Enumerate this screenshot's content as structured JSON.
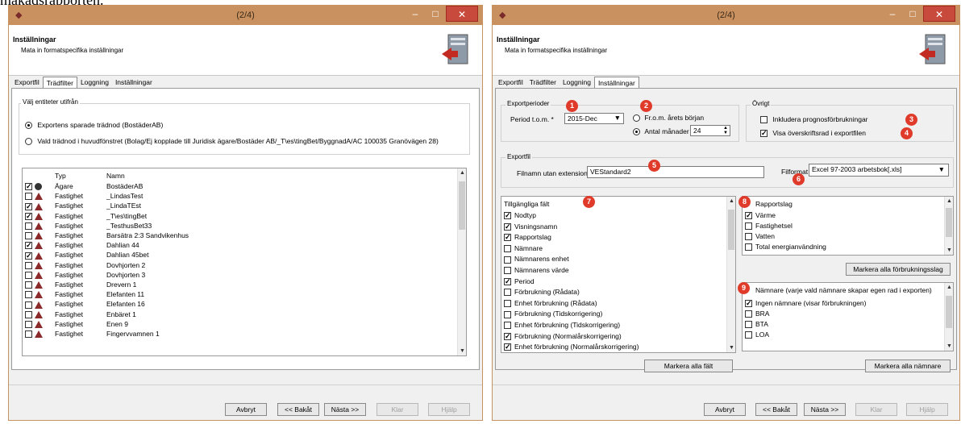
{
  "top_text": "makadsrapporten.",
  "window1": {
    "title": "(2/4)",
    "header": {
      "title": "Inställningar",
      "subtitle": "Mata in formatspecifika inställningar"
    },
    "tabs": [
      "Exportfil",
      "Trädfilter",
      "Loggning",
      "Inställningar"
    ],
    "group_label": "Välj entiteter utifrån",
    "radio1": "Exportens sparade trädnod (BostäderAB)",
    "radio2": "Vald trädnod i huvudfönstret (Bolag/Ej kopplade till Juridisk ägare/Bostäder AB/_T\\es\\tingBet/ByggnadA/AC 100035 Granövägen 28)",
    "columns": {
      "typ": "Typ",
      "namn": "Namn"
    },
    "rows": [
      {
        "checked": true,
        "icon": "owner-icon",
        "typ": "Ägare",
        "namn": "BostäderAB"
      },
      {
        "checked": false,
        "icon": "property-icon",
        "typ": "Fastighet",
        "namn": "_LindasTest"
      },
      {
        "checked": true,
        "icon": "property-icon",
        "typ": "Fastighet",
        "namn": "_LindaTEst"
      },
      {
        "checked": true,
        "icon": "property-icon",
        "typ": "Fastighet",
        "namn": "_T\\es\\tingBet"
      },
      {
        "checked": false,
        "icon": "property-icon",
        "typ": "Fastighet",
        "namn": "_TesthusBet33"
      },
      {
        "checked": false,
        "icon": "property-icon",
        "typ": "Fastighet",
        "namn": "Barsätra 2:3 Sandvikenhus"
      },
      {
        "checked": true,
        "icon": "property-icon",
        "typ": "Fastighet",
        "namn": "Dahlian 44"
      },
      {
        "checked": true,
        "icon": "property-icon",
        "typ": "Fastighet",
        "namn": "Dahlian 45bet"
      },
      {
        "checked": false,
        "icon": "property-icon",
        "typ": "Fastighet",
        "namn": "Dovhjorten 2"
      },
      {
        "checked": false,
        "icon": "property-icon",
        "typ": "Fastighet",
        "namn": "Dovhjorten 3"
      },
      {
        "checked": false,
        "icon": "property-icon",
        "typ": "Fastighet",
        "namn": "Drevern 1"
      },
      {
        "checked": false,
        "icon": "property-icon",
        "typ": "Fastighet",
        "namn": "Elefanten 11"
      },
      {
        "checked": false,
        "icon": "property-icon",
        "typ": "Fastighet",
        "namn": "Elefanten 16"
      },
      {
        "checked": false,
        "icon": "property-icon",
        "typ": "Fastighet",
        "namn": "Enbäret 1"
      },
      {
        "checked": false,
        "icon": "property-icon",
        "typ": "Fastighet",
        "namn": "Enen 9"
      },
      {
        "checked": false,
        "icon": "property-icon",
        "typ": "Fastighet",
        "namn": "Fingervvamnen 1"
      }
    ],
    "buttons": {
      "cancel": "Avbryt",
      "back": "<< Bakåt",
      "next": "Nästa >>",
      "finish": "Klar",
      "help": "Hjälp"
    }
  },
  "window2": {
    "title": "(2/4)",
    "header": {
      "title": "Inställningar",
      "subtitle": "Mata in formatspecifika inställningar"
    },
    "tabs": [
      "Exportfil",
      "Trädfilter",
      "Loggning",
      "Inställningar"
    ],
    "exportperioder": {
      "label": "Exportperioder",
      "period_label": "Period t.o.m. *",
      "period_value": "2015-Dec",
      "radio_from_year": "Fr.o.m. årets början",
      "radio_months": "Antal månader",
      "months_value": "24"
    },
    "ovrigt": {
      "label": "Övrigt",
      "cb_prognos": "Inkludera prognosförbrukningar",
      "cb_header_row": "Visa överskriftsrad i exportfilen"
    },
    "exportfil": {
      "label": "Exportfil",
      "filename_label": "Filnamn utan extension",
      "filename_value": "VEStandard2",
      "format_label": "Filformat",
      "format_value": "Excel 97-2003 arbetsbok[.xls]"
    },
    "available_fields": {
      "title": "Tillgängliga fält",
      "items": [
        {
          "checked": true,
          "label": "Nodtyp"
        },
        {
          "checked": true,
          "label": "Visningsnamn"
        },
        {
          "checked": true,
          "label": "Rapportslag"
        },
        {
          "checked": false,
          "label": "Nämnare"
        },
        {
          "checked": false,
          "label": "Nämnarens enhet"
        },
        {
          "checked": false,
          "label": "Nämnarens värde"
        },
        {
          "checked": true,
          "label": "Period"
        },
        {
          "checked": false,
          "label": "Förbrukning (Rådata)"
        },
        {
          "checked": false,
          "label": "Enhet förbrukning (Rådata)"
        },
        {
          "checked": false,
          "label": "Förbrukning (Tidskorrigering)"
        },
        {
          "checked": false,
          "label": "Enhet förbrukning (Tidskorrigering)"
        },
        {
          "checked": true,
          "label": "Förbrukning (Normalårskorrigering)"
        },
        {
          "checked": true,
          "label": "Enhet förbrukning (Normalårskorrigering)"
        }
      ],
      "button": "Markera alla fält"
    },
    "report_types": {
      "title": "Rapportslag",
      "items": [
        {
          "checked": true,
          "label": "Värme"
        },
        {
          "checked": false,
          "label": "Fastighetsel"
        },
        {
          "checked": false,
          "label": "Vatten"
        },
        {
          "checked": false,
          "label": "Total energianvändning"
        }
      ],
      "button": "Markera alla förbrukningsslag"
    },
    "denominators": {
      "title": "Nämnare (varje vald nämnare skapar egen rad i exporten)",
      "items": [
        {
          "checked": true,
          "label": "Ingen nämnare (visar förbrukningen)"
        },
        {
          "checked": false,
          "label": "BRA"
        },
        {
          "checked": false,
          "label": "BTA"
        },
        {
          "checked": false,
          "label": "LOA"
        }
      ],
      "button": "Markera alla nämnare"
    },
    "badges": [
      "1",
      "2",
      "3",
      "4",
      "5",
      "6",
      "7",
      "8",
      "9"
    ],
    "buttons": {
      "cancel": "Avbryt",
      "back": "<< Bakåt",
      "next": "Nästa >>",
      "finish": "Klar",
      "help": "Hjälp"
    }
  },
  "colors": {
    "titlebar": "#c9915f",
    "close": "#c74a3c",
    "badge": "#e03a2a"
  }
}
